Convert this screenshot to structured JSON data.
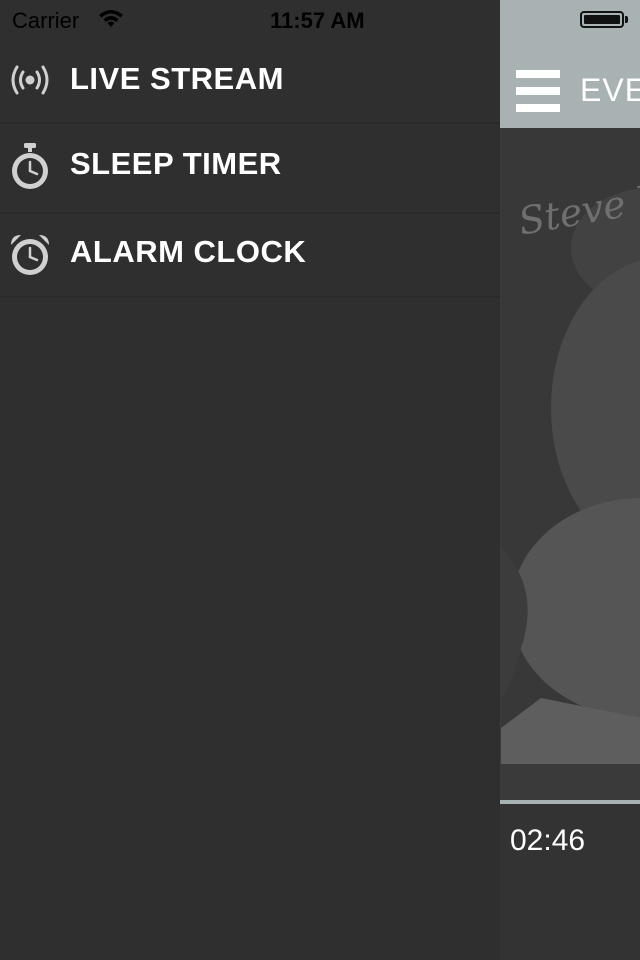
{
  "status_bar": {
    "carrier": "Carrier",
    "time": "11:57 AM",
    "wifi_icon": "wifi-icon",
    "battery_icon": "battery-icon",
    "battery_level": 1.0
  },
  "menu": {
    "items": [
      {
        "label": "LIVE STREAM",
        "icon": "broadcast-icon"
      },
      {
        "label": "SLEEP TIMER",
        "icon": "stopwatch-icon"
      },
      {
        "label": "ALARM CLOCK",
        "icon": "alarm-clock-icon"
      }
    ]
  },
  "main": {
    "menu_icon": "hamburger-menu-icon",
    "title": "EVE",
    "album_signature": "Steve W",
    "elapsed_time": "02:46"
  },
  "colors": {
    "drawer_background": "#2f2f2f",
    "topbar_accent": "#a9b2b3",
    "menu_text": "#ffffff",
    "icon_gray": "#cfcfcf"
  }
}
